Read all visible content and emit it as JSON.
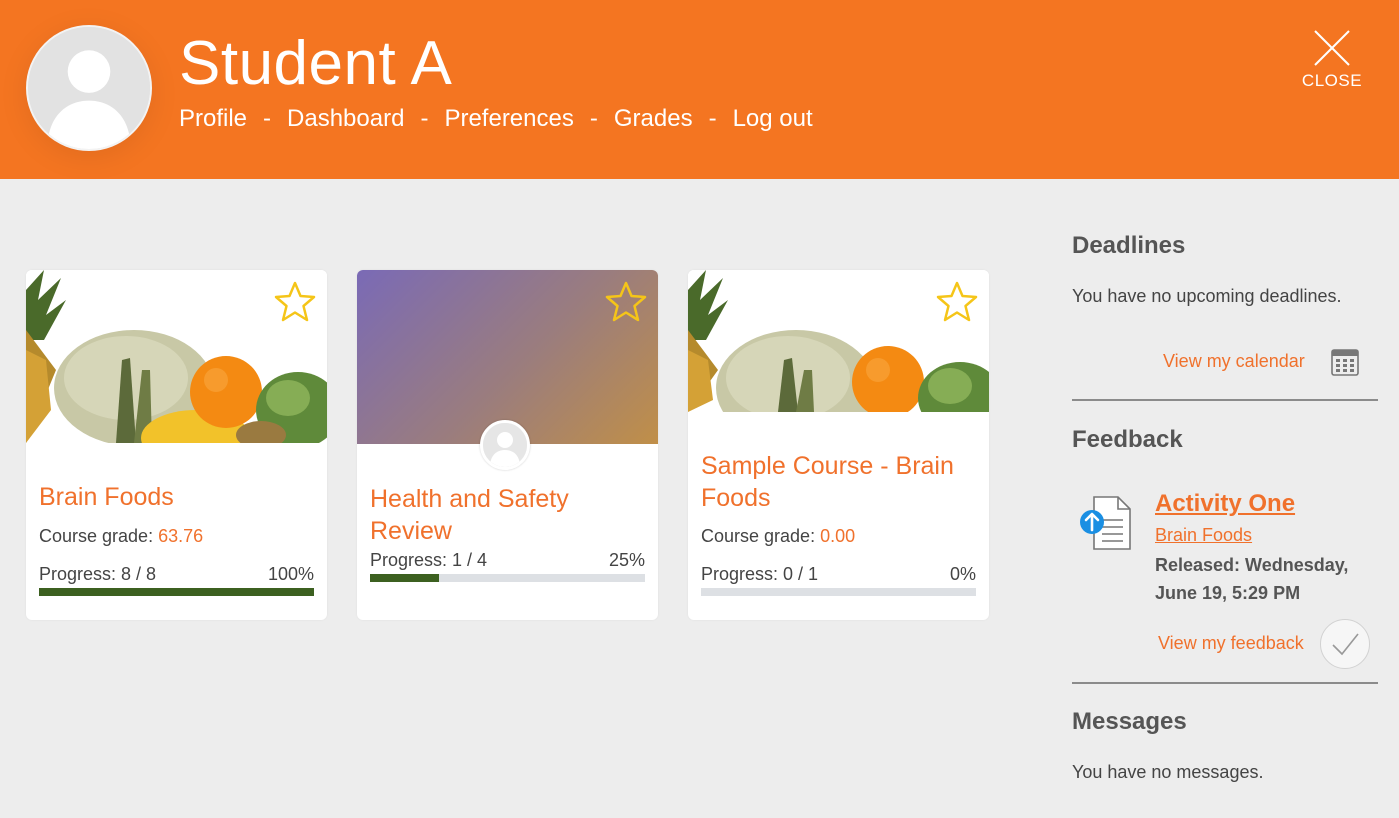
{
  "header": {
    "user_name": "Student A",
    "nav": [
      {
        "label": "Profile"
      },
      {
        "label": "Dashboard"
      },
      {
        "label": "Preferences"
      },
      {
        "label": "Grades"
      },
      {
        "label": "Log out"
      }
    ],
    "nav_separator": "-",
    "close_label": "CLOSE",
    "background_color": "#f47521"
  },
  "courses": [
    {
      "title": "Brain Foods",
      "image": "fruit-and-vegetables-photo",
      "grade_label": "Course grade:",
      "grade_value": "63.76",
      "progress_label": "Progress: 8 / 8",
      "progress_percent": "100%",
      "progress_fraction": 1.0
    },
    {
      "title": "Health and Safety Review",
      "image": "purple-orange-gradient",
      "progress_label": "Progress: 1 / 4",
      "progress_percent": "25%",
      "progress_fraction": 0.25
    },
    {
      "title": "Sample Course - Brain Foods",
      "image": "fruit-and-vegetables-photo",
      "grade_label": "Course grade:",
      "grade_value": "0.00",
      "progress_label": "Progress: 0 / 1",
      "progress_percent": "0%",
      "progress_fraction": 0.0
    }
  ],
  "sidebar": {
    "deadlines": {
      "title": "Deadlines",
      "text": "You have no upcoming deadlines.",
      "link": "View my calendar",
      "icon": "calendar-icon"
    },
    "feedback": {
      "title": "Feedback",
      "activity": "Activity One",
      "course": "Brain Foods",
      "released": "Released: Wednesday, June 19, 5:29 PM",
      "link": "View my feedback",
      "icon": "assignment-upload-icon"
    },
    "messages": {
      "title": "Messages",
      "text": "You have no messages."
    }
  },
  "colors": {
    "accent": "#f0712c",
    "progress": "#3c6020",
    "star": "#f5c518"
  }
}
